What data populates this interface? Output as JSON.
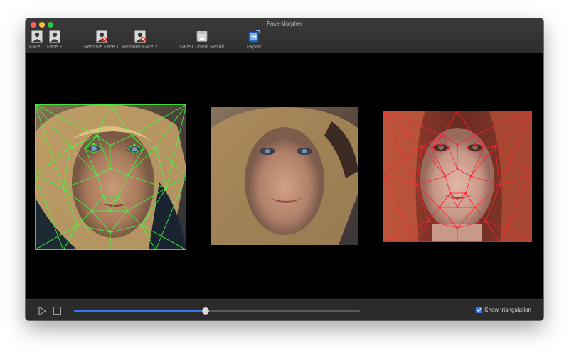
{
  "window": {
    "title": "Face Morpher"
  },
  "toolbar": {
    "face1_label": "Face 1",
    "face2_label": "Face 2",
    "remove_face1_label": "Remove Face 1",
    "remove_face2_label": "Remove Face 2",
    "save_label": "Save Current Result",
    "export_label": "Export"
  },
  "controls": {
    "progress": 0.46,
    "show_triangulation_label": "Show triangulation",
    "show_triangulation_checked": true
  },
  "colors": {
    "face1_mesh": "#3cff3c",
    "face2_mesh": "#ff2030",
    "accent": "#3478f6"
  }
}
